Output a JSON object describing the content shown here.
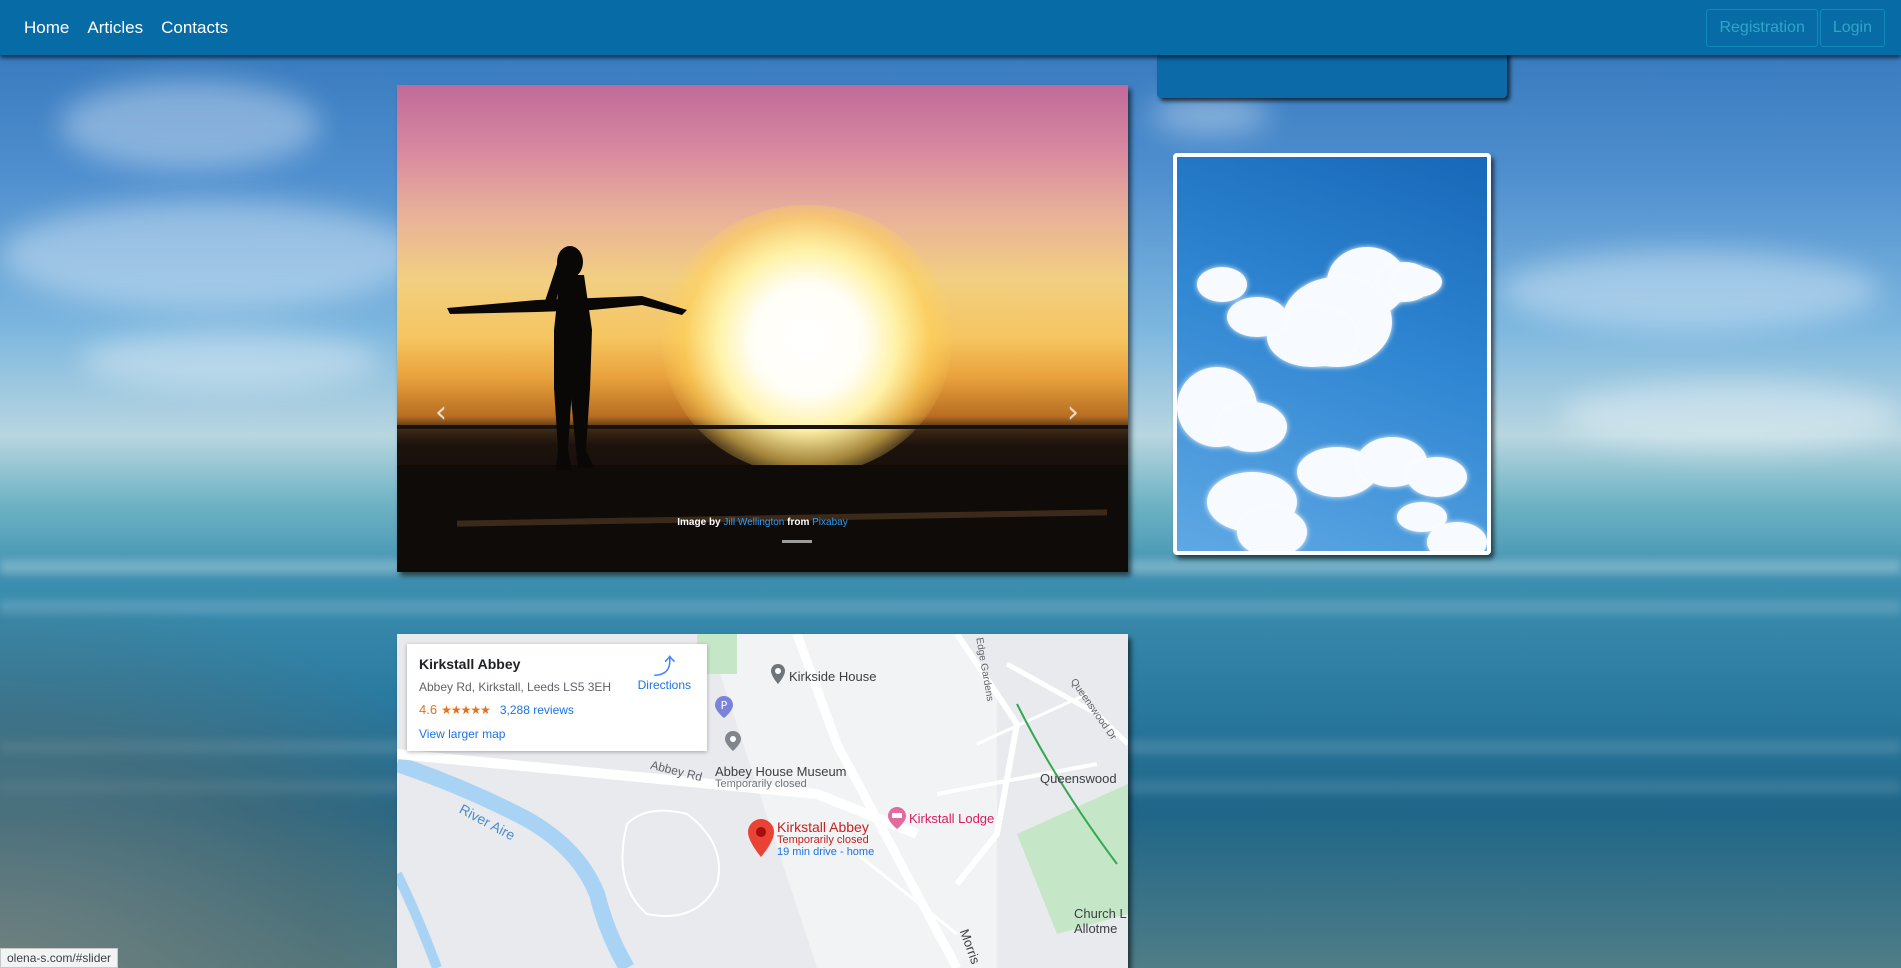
{
  "navbar": {
    "links": [
      "Home",
      "Articles",
      "Contacts"
    ],
    "registration_label": "Registration",
    "login_label": "Login"
  },
  "slider": {
    "caption_prefix": "Image by ",
    "caption_author": "Jill Wellington",
    "caption_middle": " from ",
    "caption_source": "Pixabay",
    "prev_icon": "chevron-left-icon",
    "next_icon": "chevron-right-icon"
  },
  "map": {
    "place_title": "Kirkstall Abbey",
    "address": "Abbey Rd, Kirkstall, Leeds LS5 3EH",
    "rating": "4.6",
    "stars": "★★★★★",
    "reviews": "3,288 reviews",
    "larger_map": "View larger map",
    "directions": "Directions",
    "labels": {
      "kirkside_house": "Kirkside House",
      "abbey_house_museum": "Abbey House Museum",
      "abbey_house_status": "Temporarily closed",
      "abbey_rd": "Abbey Rd",
      "river_aire": "River Aire",
      "queenswood": "Queenswood",
      "queenswood_dr": "Queenswood Dr",
      "kirkstall_lodge": "Kirkstall Lodge",
      "kirkstall_abbey": "Kirkstall Abbey",
      "kirkstall_abbey_status": "Temporarily closed",
      "kirkstall_abbey_drive": "19 min drive - home",
      "church_l": "Church L",
      "allotme": "Allotme",
      "edge_gardens": "Edge Gardens",
      "morris": "Morris"
    }
  },
  "status_bar": {
    "url": "olena-s.com/#slider"
  },
  "colors": {
    "navbar": "#076ba6",
    "button_text": "#2fa6c9",
    "link_blue": "#1a73e8",
    "rating_orange": "#e7711b",
    "pin_red": "#ea4335",
    "lodge_pink": "#d81b60"
  }
}
